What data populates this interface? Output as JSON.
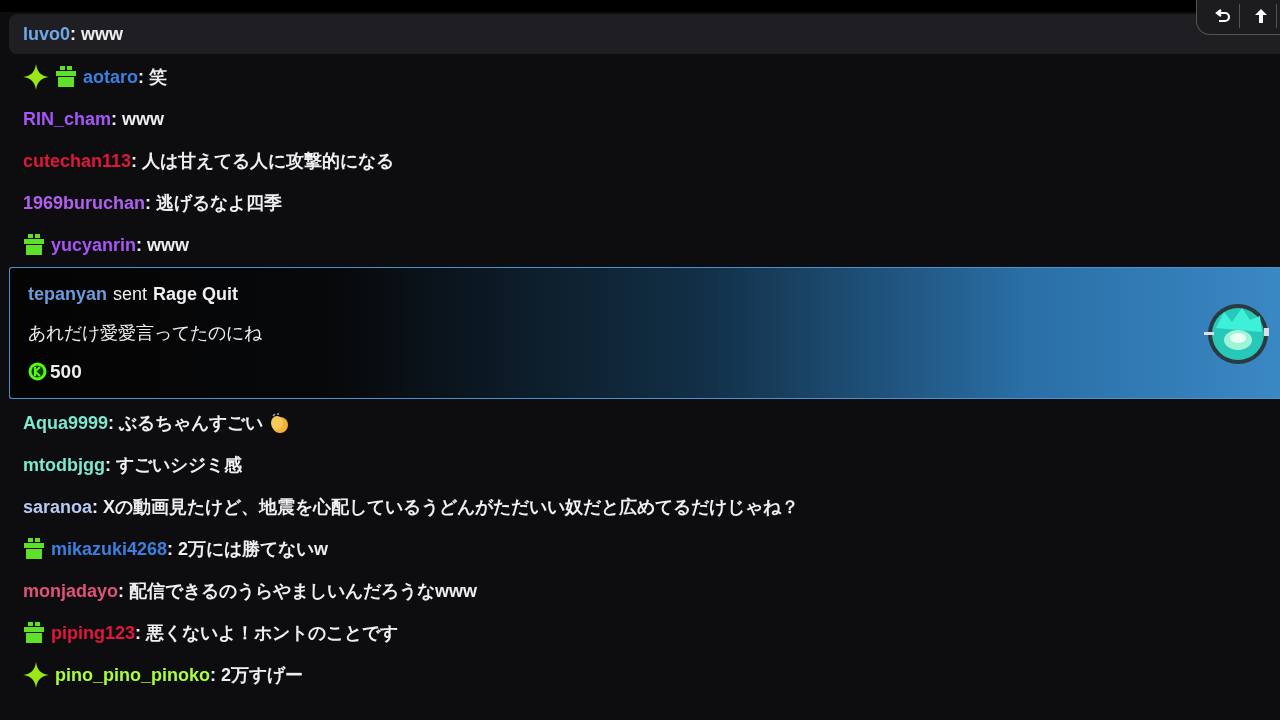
{
  "messages": [
    {
      "kind": "chat",
      "highlighted": true,
      "sparkle": false,
      "gift": false,
      "clap": false,
      "user": "luvo0",
      "color": "#6fa8e8",
      "text": ": www"
    },
    {
      "kind": "chat",
      "highlighted": false,
      "sparkle": true,
      "gift": true,
      "clap": false,
      "user": "aotaro",
      "color": "#3b7fe0",
      "text": ": 笑"
    },
    {
      "kind": "chat",
      "highlighted": false,
      "sparkle": false,
      "gift": false,
      "clap": false,
      "user": "RIN_cham",
      "color": "#a855f7",
      "text": ": www"
    },
    {
      "kind": "chat",
      "highlighted": false,
      "sparkle": false,
      "gift": false,
      "clap": false,
      "user": "cutechan113",
      "color": "#e0163c",
      "text": ": 人は甘えてる人に攻撃的になる"
    },
    {
      "kind": "chat",
      "highlighted": false,
      "sparkle": false,
      "gift": false,
      "clap": false,
      "user": "1969buruchan",
      "color": "#b060f0",
      "text": ": 逃げるなよ四季"
    },
    {
      "kind": "chat",
      "highlighted": false,
      "sparkle": false,
      "gift": true,
      "clap": false,
      "user": "yucyanrin",
      "color": "#a855f7",
      "text": ": www"
    },
    {
      "kind": "gift",
      "user": "tepanyan",
      "color": "#6b9bd8",
      "action": "sent",
      "gift_name": "Rage Quit",
      "text": "あれだけ愛愛言ってたのにね",
      "amount": "500"
    },
    {
      "kind": "chat",
      "highlighted": false,
      "sparkle": false,
      "gift": false,
      "clap": true,
      "user": "Aqua9999",
      "color": "#7ee8d0",
      "text": ": ぶるちゃんすごい"
    },
    {
      "kind": "chat",
      "highlighted": false,
      "sparkle": false,
      "gift": false,
      "clap": false,
      "user": "mtodbjgg",
      "color": "#7ee8d0",
      "text": ": すごいシジミ感"
    },
    {
      "kind": "chat",
      "highlighted": false,
      "sparkle": false,
      "gift": false,
      "clap": false,
      "user": "saranoa",
      "color": "#b8c8f0",
      "text": ": Xの動画見たけど、地震を心配しているうどんがただいい奴だと広めてるだけじゃね？"
    },
    {
      "kind": "chat",
      "highlighted": false,
      "sparkle": false,
      "gift": true,
      "clap": false,
      "user": "mikazuki4268",
      "color": "#3b7fe0",
      "text": ": 2万には勝てないw"
    },
    {
      "kind": "chat",
      "highlighted": false,
      "sparkle": false,
      "gift": false,
      "clap": false,
      "user": "monjadayo",
      "color": "#e0527a",
      "text": ": 配信できるのうらやましいんだろうなwww"
    },
    {
      "kind": "chat",
      "highlighted": false,
      "sparkle": false,
      "gift": true,
      "clap": false,
      "user": "piping123",
      "color": "#e0163c",
      "text": ": 悪くないよ！ホントのことです"
    },
    {
      "kind": "chat",
      "highlighted": false,
      "sparkle": true,
      "gift": false,
      "clap": false,
      "user": "pino_pino_pinoko",
      "color": "#a8ff3a",
      "text": ": 2万すげー"
    }
  ]
}
